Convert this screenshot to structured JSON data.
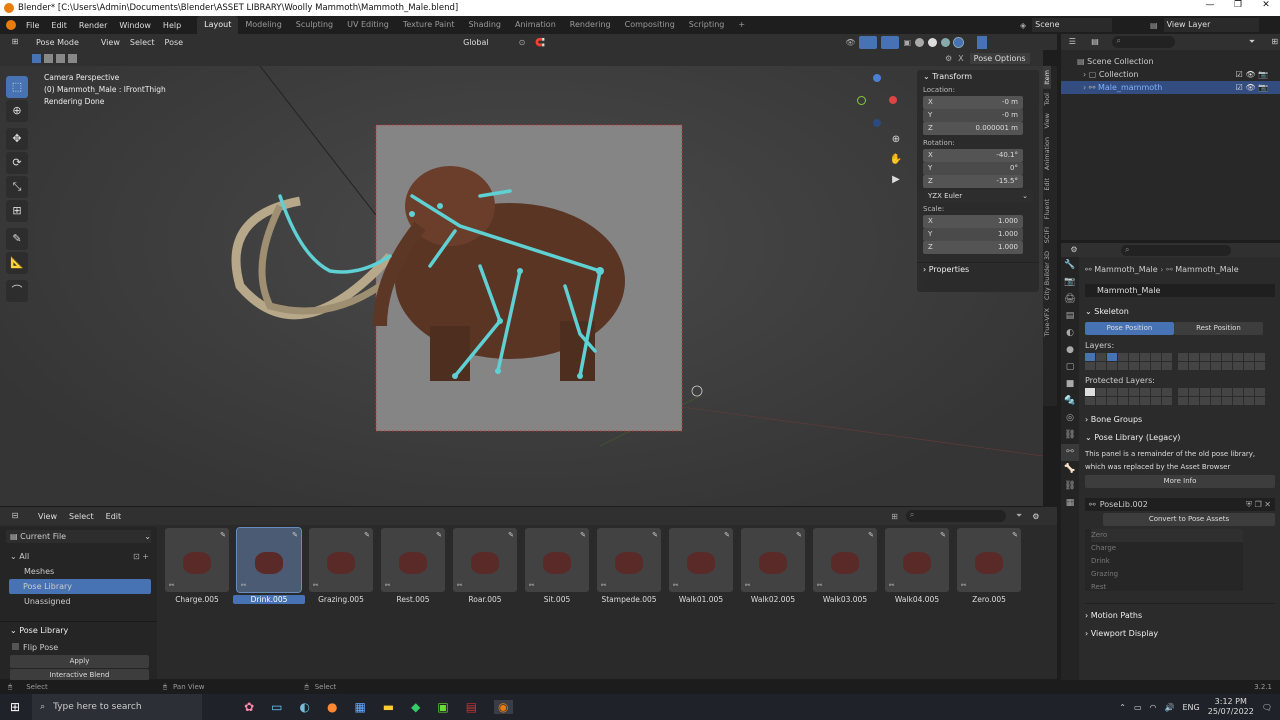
{
  "window": {
    "title": "Blender* [C:\\Users\\Admin\\Documents\\Blender\\ASSET LIBRARY\\Woolly Mammoth\\Mammoth_Male.blend]"
  },
  "menu": {
    "items": [
      "File",
      "Edit",
      "Render",
      "Window",
      "Help"
    ]
  },
  "workspaces": [
    "Layout",
    "Modeling",
    "Sculpting",
    "UV Editing",
    "Texture Paint",
    "Shading",
    "Animation",
    "Rendering",
    "Compositing",
    "Scripting",
    "+"
  ],
  "scene": {
    "label": "Scene"
  },
  "viewlayer": {
    "label": "View Layer"
  },
  "vp_header": {
    "mode": "Pose Mode",
    "view": "View",
    "select": "Select",
    "pose": "Pose",
    "orientation": "Global",
    "pose_options": "Pose Options"
  },
  "overlay_text": {
    "line1": "Camera Perspective",
    "line2": "(0) Mammoth_Male : lFrontThigh",
    "line3": "Rendering Done"
  },
  "npanel": {
    "title": "Transform",
    "location": "Location:",
    "loc_x": "-0 m",
    "loc_y": "-0 m",
    "loc_z": "0.000001 m",
    "rotation": "Rotation:",
    "rot_x": "-40.1°",
    "rot_y": "0°",
    "rot_z": "-15.5°",
    "euler": "YZX Euler",
    "scale": "Scale:",
    "sc_x": "1.000",
    "sc_y": "1.000",
    "sc_z": "1.000",
    "properties": "Properties",
    "axis_x": "X",
    "axis_y": "Y",
    "axis_z": "Z"
  },
  "side_tabs": [
    "Item",
    "Tool",
    "View",
    "Animation",
    "Edit",
    "Fluent",
    "SCIFI",
    "City Builder 3D",
    "True-VFX"
  ],
  "outliner": {
    "scene_collection": "Scene Collection",
    "collection": "Collection",
    "object": "Male_mammoth"
  },
  "props": {
    "breadcrumb1": "Mammoth_Male",
    "breadcrumb2": "Mammoth_Male",
    "datablock": "Mammoth_Male",
    "skeleton": "Skeleton",
    "pose_position": "Pose Position",
    "rest_position": "Rest Position",
    "layers": "Layers:",
    "protected_layers": "Protected Layers:",
    "bone_groups": "Bone Groups",
    "pose_library_legacy": "Pose Library (Legacy)",
    "legacy_note1": "This panel is a remainder of the old pose library,",
    "legacy_note2": "which was replaced by the Asset Browser",
    "more_info": "More Info",
    "poselib": "PoseLib.002",
    "convert": "Convert to Pose Assets",
    "poses": [
      "Zero",
      "Charge",
      "Drink",
      "Grazing",
      "Rest"
    ],
    "motion_paths": "Motion Paths",
    "viewport_display": "Viewport Display"
  },
  "asset_header": {
    "view": "View",
    "select": "Select",
    "edit": "Edit",
    "library": "Current File"
  },
  "asset_left": {
    "all": "All",
    "meshes": "Meshes",
    "pose_library": "Pose Library",
    "unassigned": "Unassigned",
    "panel": "Pose Library",
    "flip_pose": "Flip Pose",
    "apply": "Apply",
    "interactive_blend": "Interactive Blend"
  },
  "assets": [
    {
      "name": "Charge.005",
      "selected": false
    },
    {
      "name": "Drink.005",
      "selected": true
    },
    {
      "name": "Grazing.005",
      "selected": false
    },
    {
      "name": "Rest.005",
      "selected": false
    },
    {
      "name": "Roar.005",
      "selected": false
    },
    {
      "name": "Sit.005",
      "selected": false
    },
    {
      "name": "Stampede.005",
      "selected": false
    },
    {
      "name": "Walk01.005",
      "selected": false
    },
    {
      "name": "Walk02.005",
      "selected": false
    },
    {
      "name": "Walk03.005",
      "selected": false
    },
    {
      "name": "Walk04.005",
      "selected": false
    },
    {
      "name": "Zero.005",
      "selected": false
    }
  ],
  "status": {
    "select": "Select",
    "pan_view": "Pan View",
    "select2": "Select",
    "version": "3.2.1"
  },
  "taskbar": {
    "search_placeholder": "Type here to search",
    "time": "3:12 PM",
    "date": "25/07/2022",
    "lang": "ENG"
  },
  "colors": {
    "accent": "#4772b3",
    "bone": "#5fd0d3",
    "orange": "#e87d0d"
  }
}
